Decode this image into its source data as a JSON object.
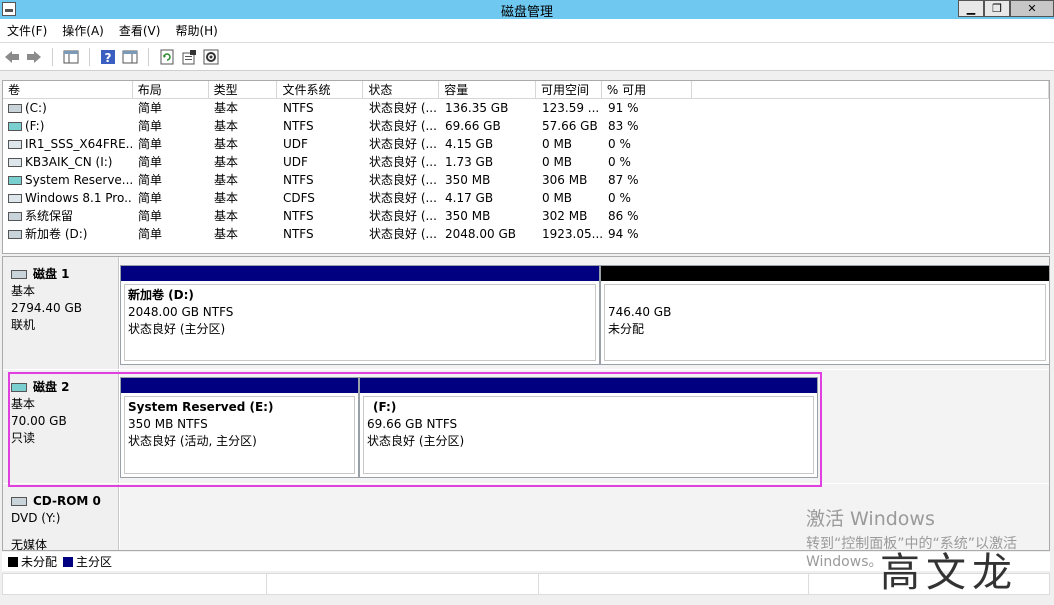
{
  "window": {
    "title": "磁盘管理"
  },
  "menu": [
    "文件(F)",
    "操作(A)",
    "查看(V)",
    "帮助(H)"
  ],
  "toolbar": [
    "back-icon",
    "forward-icon",
    "show-pane-icon",
    "help-icon",
    "show-console-tree-icon",
    "refresh-icon",
    "properties-icon",
    "settings-icon"
  ],
  "volumes": {
    "columns": [
      "卷",
      "布局",
      "类型",
      "文件系统",
      "状态",
      "容量",
      "可用空间",
      "% 可用"
    ],
    "rows": [
      [
        "(C:)",
        "简单",
        "基本",
        "NTFS",
        "状态良好 (...",
        "136.35 GB",
        "123.59 ...",
        "91 %"
      ],
      [
        "(F:)",
        "简单",
        "基本",
        "NTFS",
        "状态良好 (...",
        "69.66 GB",
        "57.66 GB",
        "83 %"
      ],
      [
        "IR1_SSS_X64FRE...",
        "简单",
        "基本",
        "UDF",
        "状态良好 (...",
        "4.15 GB",
        "0 MB",
        "0 %"
      ],
      [
        "KB3AIK_CN (I:)",
        "简单",
        "基本",
        "UDF",
        "状态良好 (...",
        "1.73 GB",
        "0 MB",
        "0 %"
      ],
      [
        "System Reserve...",
        "简单",
        "基本",
        "NTFS",
        "状态良好 (...",
        "350 MB",
        "306 MB",
        "87 %"
      ],
      [
        "Windows 8.1 Pro...",
        "简单",
        "基本",
        "CDFS",
        "状态良好 (...",
        "4.17 GB",
        "0 MB",
        "0 %"
      ],
      [
        "系统保留",
        "简单",
        "基本",
        "NTFS",
        "状态良好 (...",
        "350 MB",
        "302 MB",
        "86 %"
      ],
      [
        "新加卷 (D:)",
        "简单",
        "基本",
        "NTFS",
        "状态良好 (...",
        "2048.00 GB",
        "1923.05...",
        "94 %"
      ]
    ]
  },
  "disks": {
    "disk1": {
      "name": "磁盘 1",
      "type": "基本",
      "size": "2794.40 GB",
      "status": "联机",
      "p1": {
        "name": "新加卷  (D:)",
        "size": "2048.00 GB NTFS",
        "status": "状态良好 (主分区)"
      },
      "p2": {
        "size": "746.40 GB",
        "status": "未分配"
      }
    },
    "disk2": {
      "name": "磁盘 2",
      "type": "基本",
      "size": "70.00 GB",
      "status": "只读",
      "p1": {
        "name": "System Reserved  (E:)",
        "size": "350 MB NTFS",
        "status": "状态良好 (活动, 主分区)"
      },
      "p2": {
        "name": "(F:)",
        "size": "69.66 GB NTFS",
        "status": "状态良好 (主分区)"
      }
    },
    "cdrom": {
      "name": "CD-ROM 0",
      "type": "DVD (Y:)",
      "status": "无媒体"
    }
  },
  "legend": {
    "unallocated": "未分配",
    "primary": "主分区"
  },
  "watermark": {
    "line1": "激活 Windows",
    "line2": "转到“控制面板”中的“系统”以激活",
    "line3": "Windows。"
  },
  "signature": "高文龙",
  "colors": {
    "titlebar": "#6ec8f0",
    "primary_partition": "#000080",
    "unallocated": "#000000",
    "highlight": "#e040e0"
  }
}
